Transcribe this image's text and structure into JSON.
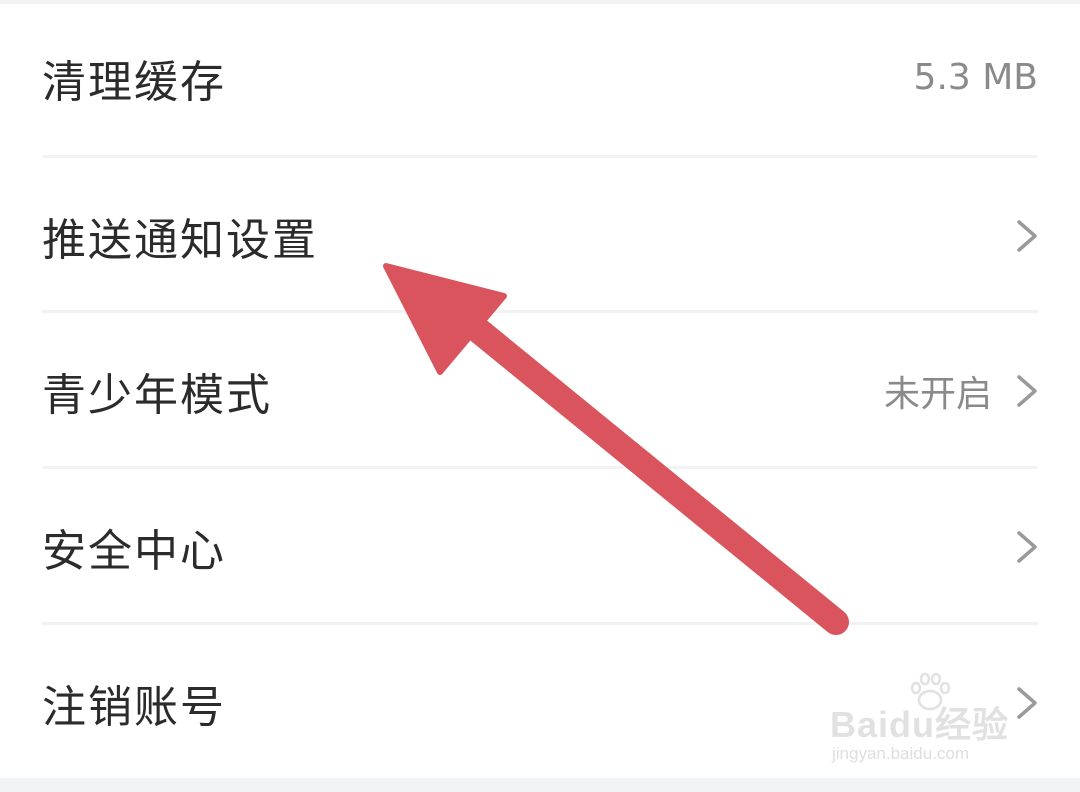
{
  "settings": {
    "items": [
      {
        "label": "清理缓存",
        "value": "5.3 MB",
        "has_chevron": false
      },
      {
        "label": "推送通知设置",
        "value": "",
        "has_chevron": true
      },
      {
        "label": "青少年模式",
        "value": "未开启",
        "has_chevron": true
      },
      {
        "label": "安全中心",
        "value": "",
        "has_chevron": true
      },
      {
        "label": "注销账号",
        "value": "",
        "has_chevron": true
      }
    ]
  },
  "annotation": {
    "type": "arrow",
    "color": "#d9545c",
    "points_to": "推送通知设置"
  },
  "watermark": {
    "brand": "Baidu经验",
    "url": "jingyan.baidu.com"
  },
  "icons": {
    "chevron": "chevron-right-icon"
  },
  "colors": {
    "label_text": "#2b2b2b",
    "value_text": "#8a8a8a",
    "chevron": "#9a9a9a",
    "divider": "#f2f2f2",
    "arrow": "#d9545c"
  }
}
